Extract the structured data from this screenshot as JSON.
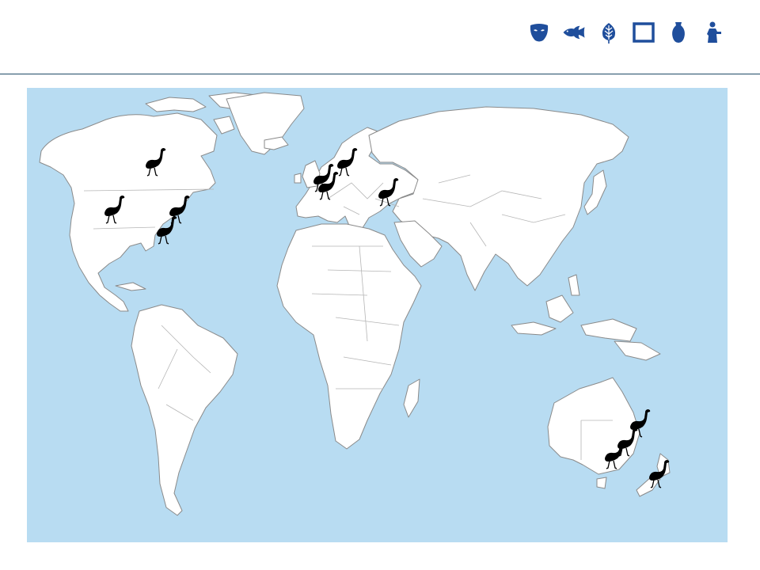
{
  "colors": {
    "ocean": "#b8dcf2",
    "land": "#ffffff",
    "country_border": "#b5b5b5",
    "icon_blue": "#1f4e9c",
    "marker": "#000000",
    "header_rule": "#1e4a66"
  },
  "header": {
    "icons": [
      "mask-icon",
      "fish-icon",
      "leaf-icon",
      "frame-icon",
      "vase-icon",
      "figure-icon"
    ]
  },
  "map": {
    "marker_icon": "emu-icon",
    "markers": [
      {
        "region": "north-america",
        "place": "great-lakes"
      },
      {
        "region": "north-america",
        "place": "western-us"
      },
      {
        "region": "north-america",
        "place": "northeast-us"
      },
      {
        "region": "north-america",
        "place": "eastern-us"
      },
      {
        "region": "europe",
        "place": "united-kingdom"
      },
      {
        "region": "europe",
        "place": "scandinavia"
      },
      {
        "region": "europe",
        "place": "central-europe"
      },
      {
        "region": "europe",
        "place": "black-sea"
      },
      {
        "region": "oceania",
        "place": "eastern-australia"
      },
      {
        "region": "oceania",
        "place": "new-south-wales"
      },
      {
        "region": "oceania",
        "place": "victoria"
      },
      {
        "region": "oceania",
        "place": "new-zealand"
      }
    ]
  }
}
